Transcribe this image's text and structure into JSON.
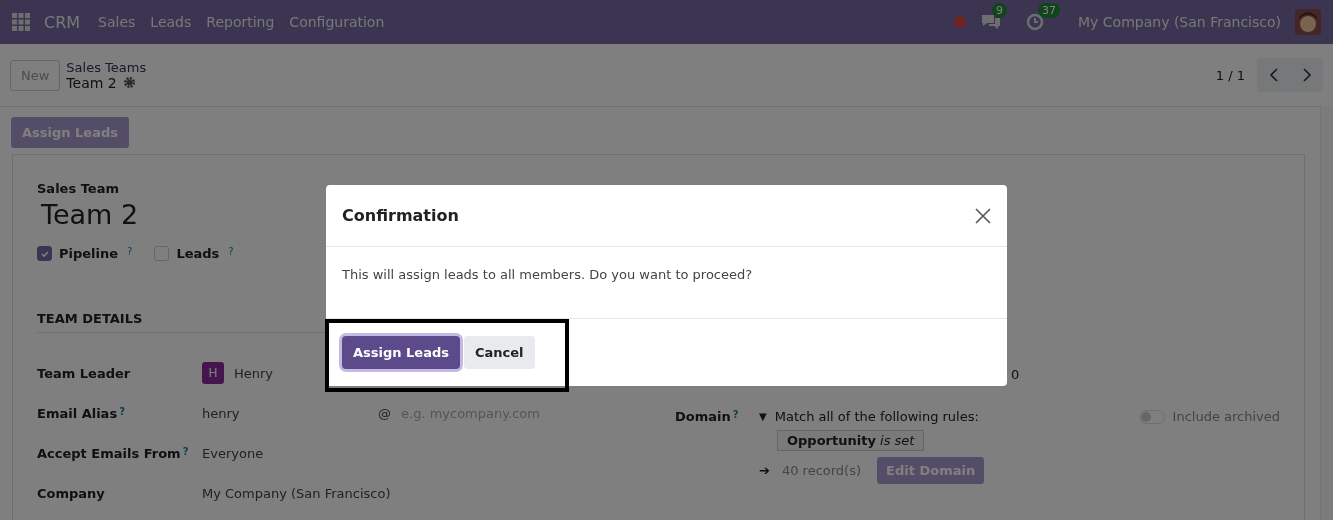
{
  "navbar": {
    "app": "CRM",
    "menu": [
      "Sales",
      "Leads",
      "Reporting",
      "Configuration"
    ],
    "messages_count": "9",
    "activities_count": "37",
    "company": "My Company (San Francisco)"
  },
  "control_panel": {
    "new_button": "New",
    "breadcrumb": "Sales Teams",
    "record": "Team 2",
    "pager": "1 / 1"
  },
  "action_button": "Assign Leads",
  "form": {
    "name_label": "Sales Team",
    "name": "Team 2",
    "options": [
      {
        "label": "Pipeline",
        "help": "?",
        "checked": true
      },
      {
        "label": "Leads",
        "help": "?",
        "checked": false
      }
    ],
    "section": "TEAM DETAILS",
    "fields": [
      {
        "label": "Team Leader",
        "kind": "user",
        "avatar": "H",
        "value": "Henry"
      },
      {
        "label": "Email Alias",
        "help": "?",
        "kind": "alias",
        "value": "henry",
        "at": "@",
        "placeholder": "e.g. mycompany.com"
      },
      {
        "label": "Accept Emails From",
        "help": "?",
        "kind": "text",
        "value": "Everyone"
      },
      {
        "label": "Company",
        "kind": "text",
        "value": "My Company (San Francisco)"
      }
    ],
    "right_partial": "0",
    "domain": {
      "label": "Domain",
      "help": "?",
      "caret": "▼",
      "match": "Match all of the following rules:",
      "archived_label": "Include archived",
      "archived_on": false,
      "rule": "**Opportunity** *is set*",
      "arrow": "➔",
      "records": "40 record(s)",
      "edit_button": "Edit Domain"
    }
  },
  "dialog": {
    "title": "Confirmation",
    "message": "This will assign leads to all members. Do you want to proceed?",
    "buttons": [
      {
        "label": "Assign Leads",
        "kind": "primary"
      },
      {
        "label": "Cancel",
        "kind": "secondary"
      }
    ]
  }
}
